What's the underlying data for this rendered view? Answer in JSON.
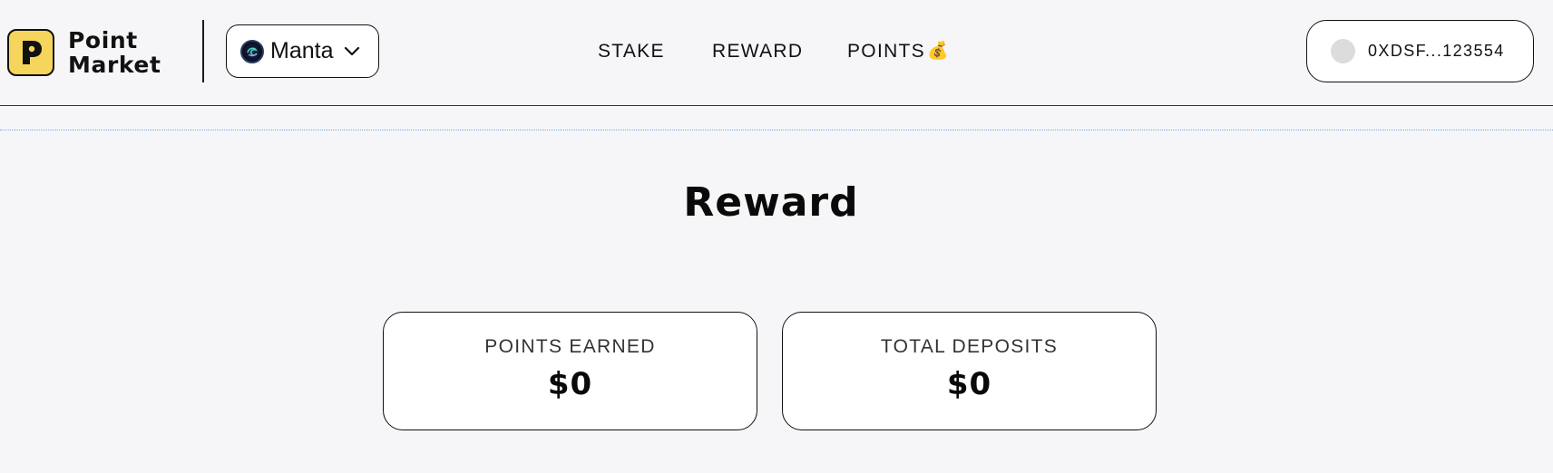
{
  "header": {
    "logo": {
      "line1": "Point",
      "line2": "Market",
      "icon": "p-logo-icon"
    },
    "network": {
      "label": "Manta",
      "icon": "manta-network-icon",
      "chevron": "chevron-down-icon"
    },
    "nav": [
      {
        "label": "STAKE"
      },
      {
        "label": "REWARD"
      },
      {
        "label": "POINTS",
        "emoji": "💰"
      }
    ],
    "wallet": {
      "address": "0XDSF...123554"
    }
  },
  "main": {
    "title": "Reward",
    "cards": [
      {
        "label": "POINTS EARNED",
        "value": "$0"
      },
      {
        "label": "TOTAL DEPOSITS",
        "value": "$0"
      }
    ]
  },
  "colors": {
    "background": "#f6f5f8",
    "logo_yellow": "#f6d55c",
    "header_border": "#1d3557",
    "dotted_line": "#7aa6e6"
  }
}
